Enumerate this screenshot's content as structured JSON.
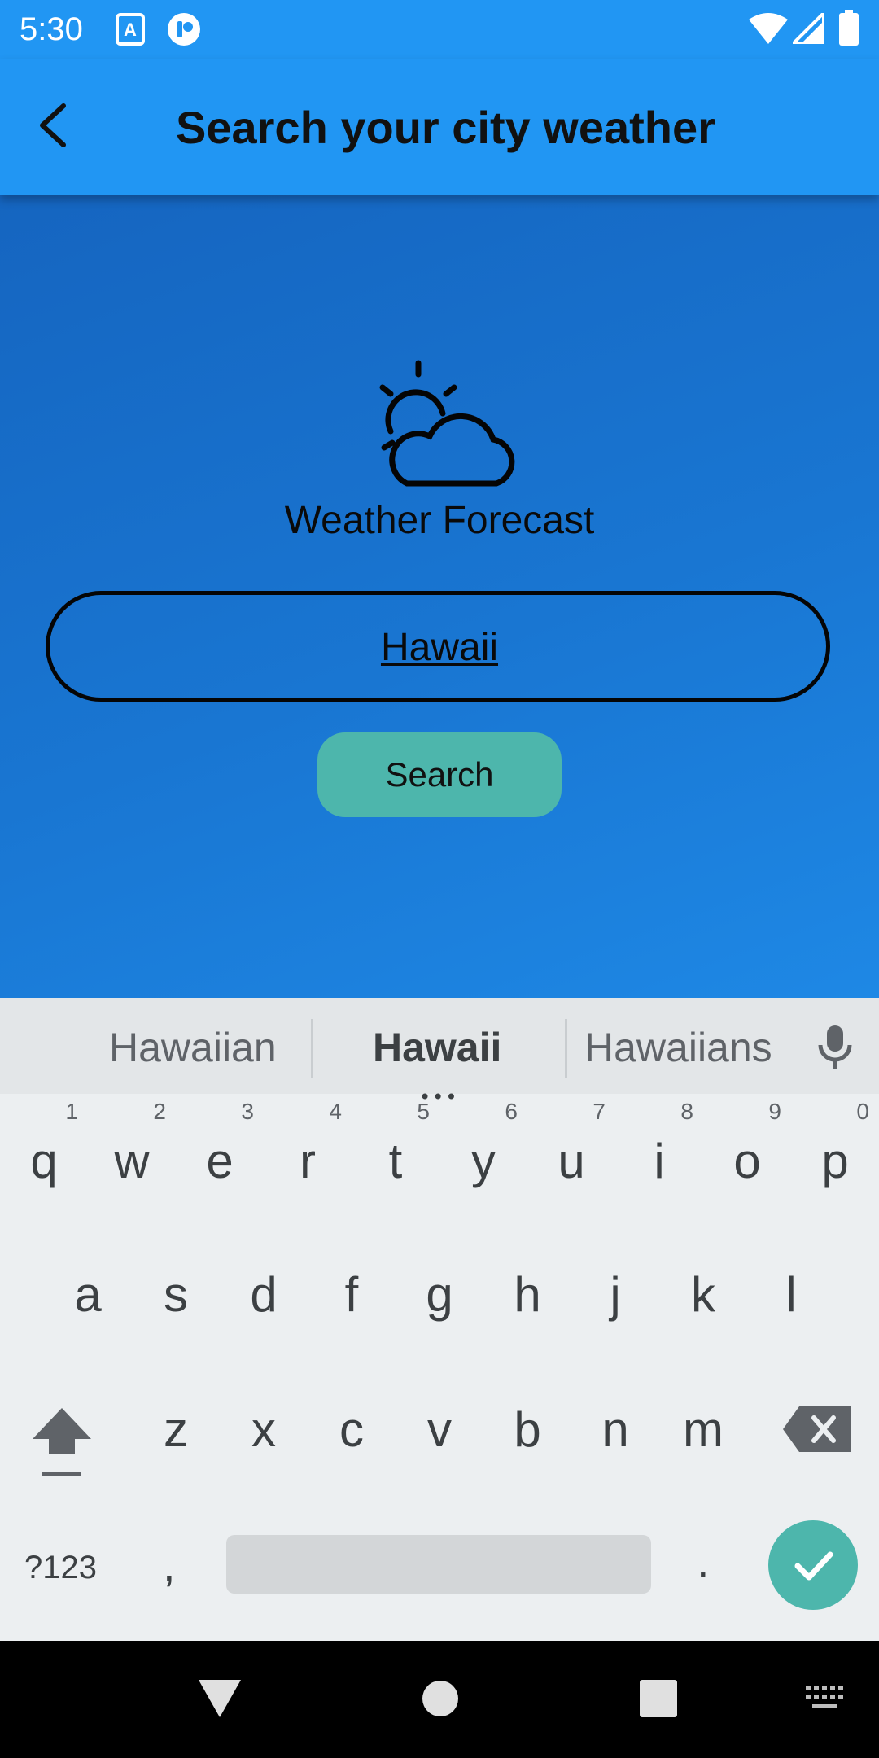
{
  "status_bar": {
    "time": "5:30",
    "icons": [
      "keyboard-a-icon",
      "app-notification-icon",
      "wifi-icon",
      "signal-icon",
      "battery-icon"
    ]
  },
  "app_bar": {
    "title": "Search your city weather",
    "back_icon": "arrow-back-icon"
  },
  "main": {
    "logo_icon": "sun-cloud-icon",
    "logo_text": "Weather Forecast",
    "search_value": "Hawaii",
    "search_button_label": "Search"
  },
  "keyboard": {
    "suggestions": [
      "Hawaiian",
      "Hawaii",
      "Hawaiians"
    ],
    "row1": [
      "q",
      "w",
      "e",
      "r",
      "t",
      "y",
      "u",
      "i",
      "o",
      "p"
    ],
    "row1_hints": [
      "1",
      "2",
      "3",
      "4",
      "5",
      "6",
      "7",
      "8",
      "9",
      "0"
    ],
    "row2": [
      "a",
      "s",
      "d",
      "f",
      "g",
      "h",
      "j",
      "k",
      "l"
    ],
    "row3": [
      "z",
      "x",
      "c",
      "v",
      "b",
      "n",
      "m"
    ],
    "symbols_key": "?123",
    "comma_key": ",",
    "period_key": "."
  },
  "colors": {
    "app_bar": "#2196f3",
    "accent": "#4db6ac",
    "keyboard_bg": "#eceff1"
  }
}
